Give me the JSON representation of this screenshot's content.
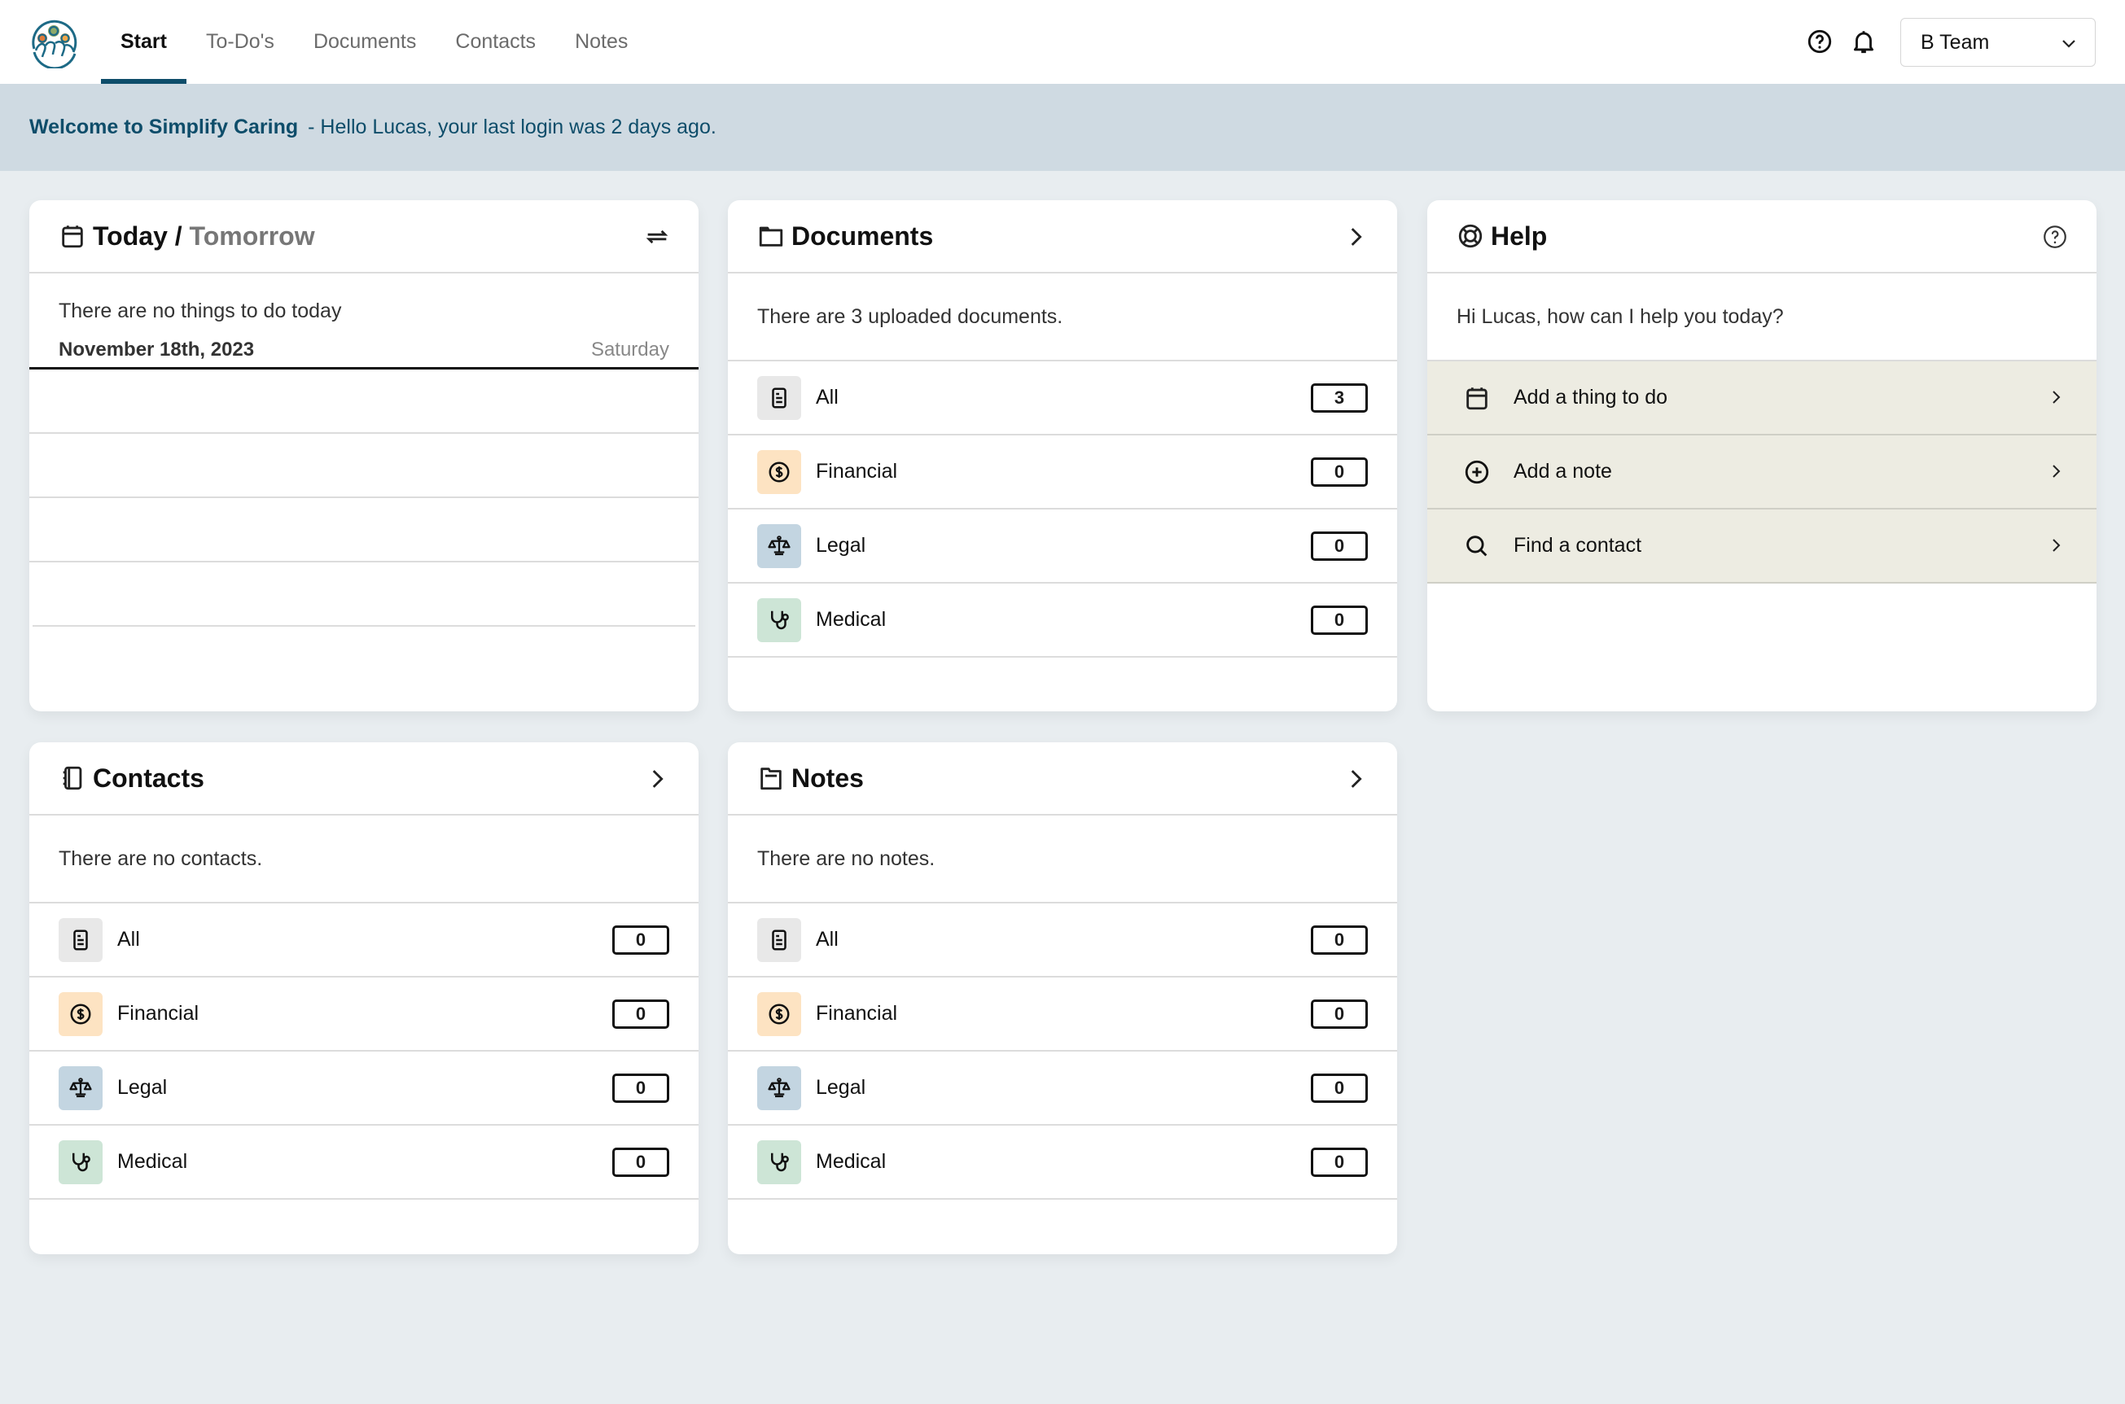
{
  "header": {
    "logo": "simplify-caring-logo",
    "nav": [
      {
        "label": "Start",
        "active": true
      },
      {
        "label": "To-Do's",
        "active": false
      },
      {
        "label": "Documents",
        "active": false
      },
      {
        "label": "Contacts",
        "active": false
      },
      {
        "label": "Notes",
        "active": false
      }
    ],
    "help_icon": "question-circle-icon",
    "bell_icon": "bell-icon",
    "team_select": {
      "value": "B Team"
    }
  },
  "banner": {
    "title": "Welcome to Simplify Caring",
    "message": "- Hello Lucas, your last login was 2 days ago."
  },
  "today_card": {
    "title_today": "Today",
    "separator": "/",
    "title_tomorrow": "Tomorrow",
    "intro": "There are no things to do today",
    "date": "November 18th, 2023",
    "weekday": "Saturday"
  },
  "documents_card": {
    "title": "Documents",
    "intro": "There are 3 uploaded documents.",
    "rows": [
      {
        "label": "All",
        "count": "3"
      },
      {
        "label": "Financial",
        "count": "0"
      },
      {
        "label": "Legal",
        "count": "0"
      },
      {
        "label": "Medical",
        "count": "0"
      }
    ]
  },
  "help_card": {
    "title": "Help",
    "intro": "Hi Lucas, how can I help you today?",
    "actions": [
      {
        "label": "Add a thing to do",
        "icon": "calendar-icon"
      },
      {
        "label": "Add a note",
        "icon": "plus-circle-icon"
      },
      {
        "label": "Find a contact",
        "icon": "search-icon"
      }
    ]
  },
  "contacts_card": {
    "title": "Contacts",
    "intro": "There are no contacts.",
    "rows": [
      {
        "label": "All",
        "count": "0"
      },
      {
        "label": "Financial",
        "count": "0"
      },
      {
        "label": "Legal",
        "count": "0"
      },
      {
        "label": "Medical",
        "count": "0"
      }
    ]
  },
  "notes_card": {
    "title": "Notes",
    "intro": "There are no notes.",
    "rows": [
      {
        "label": "All",
        "count": "0"
      },
      {
        "label": "Financial",
        "count": "0"
      },
      {
        "label": "Legal",
        "count": "0"
      },
      {
        "label": "Medical",
        "count": "0"
      }
    ]
  },
  "colors": {
    "accent": "#0e4d6a",
    "banner_bg": "#cfdae2",
    "page_bg": "#e8edf0",
    "tile_all": "#e8e8e8",
    "tile_financial": "#fde3c2",
    "tile_legal": "#c3d5e1",
    "tile_medical": "#cde5d6",
    "help_row_bg": "#edece2"
  }
}
